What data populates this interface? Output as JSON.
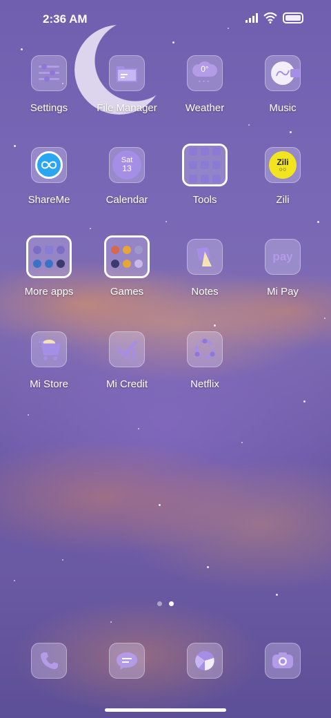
{
  "status_bar": {
    "time": "2:36 AM"
  },
  "apps": [
    {
      "key": "settings",
      "label": "Settings"
    },
    {
      "key": "file-manager",
      "label": "File Manager"
    },
    {
      "key": "weather",
      "label": "Weather",
      "temperature": "0°"
    },
    {
      "key": "music",
      "label": "Music"
    },
    {
      "key": "shareme",
      "label": "ShareMe"
    },
    {
      "key": "calendar",
      "label": "Calendar",
      "weekday": "Sat",
      "day": "13"
    },
    {
      "key": "tools",
      "label": "Tools"
    },
    {
      "key": "zili",
      "label": "Zili",
      "logo_text": "Zili"
    },
    {
      "key": "more-apps",
      "label": "More apps"
    },
    {
      "key": "games",
      "label": "Games"
    },
    {
      "key": "notes",
      "label": "Notes"
    },
    {
      "key": "mi-pay",
      "label": "Mi Pay",
      "logo_text": "pay"
    },
    {
      "key": "mi-store",
      "label": "Mi Store"
    },
    {
      "key": "mi-credit",
      "label": "Mi Credit"
    },
    {
      "key": "netflix",
      "label": "Netflix"
    }
  ],
  "dock": [
    "phone-icon",
    "messages-icon",
    "browser-icon",
    "camera-icon"
  ],
  "pager": {
    "pages": 2,
    "current": 2
  },
  "colors": {
    "icon_purple": "#b39be8",
    "accent_blue": "#2aa6f0",
    "zili_yellow": "#f2e51f"
  }
}
